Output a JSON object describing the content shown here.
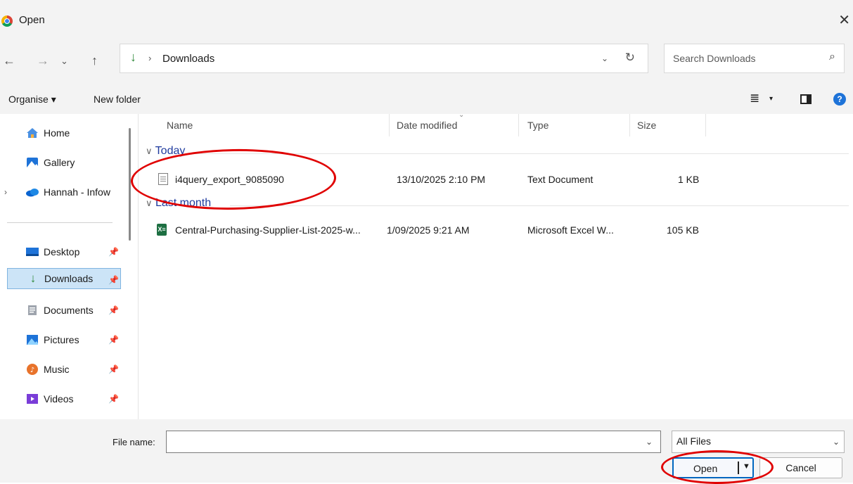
{
  "window": {
    "title": "Open",
    "close_glyph": "✕"
  },
  "nav": {
    "back": "←",
    "forward": "→",
    "recent": "⌄",
    "up": "↑"
  },
  "address": {
    "chevron": "›",
    "path": "Downloads",
    "dropdown": "⌄",
    "refresh": "↻"
  },
  "search": {
    "placeholder": "Search Downloads",
    "icon": "⌕"
  },
  "toolbar": {
    "organise": "Organise ▾",
    "new_folder": "New folder",
    "view": "≣",
    "view_drop": "▾",
    "help": "?"
  },
  "sidebar": {
    "items": [
      {
        "label": "Home",
        "icon": "home-icon",
        "pinned": false
      },
      {
        "label": "Gallery",
        "icon": "gallery-icon",
        "pinned": false
      },
      {
        "label": "Hannah - Infow",
        "icon": "onedrive-icon",
        "pinned": false
      },
      {
        "label": "Desktop",
        "icon": "desktop-icon",
        "pinned": true
      },
      {
        "label": "Downloads",
        "icon": "downloads-icon",
        "pinned": true,
        "selected": true
      },
      {
        "label": "Documents",
        "icon": "documents-icon",
        "pinned": true
      },
      {
        "label": "Pictures",
        "icon": "pictures-icon",
        "pinned": true
      },
      {
        "label": "Music",
        "icon": "music-icon",
        "pinned": true
      },
      {
        "label": "Videos",
        "icon": "videos-icon",
        "pinned": true
      }
    ],
    "expand": "›",
    "pin": "📌"
  },
  "columns": {
    "name": "Name",
    "date": "Date modified",
    "type": "Type",
    "size": "Size",
    "sort": "⌄"
  },
  "groups": [
    {
      "label": "Today",
      "chevron": "∨",
      "files": [
        {
          "name": "i4query_export_9085090",
          "date": "13/10/2025 2:10 PM",
          "type": "Text Document",
          "size": "1 KB",
          "icon": "text-file-icon"
        }
      ]
    },
    {
      "label": "Last month",
      "chevron": "∨",
      "files": [
        {
          "name": "Central-Purchasing-Supplier-List-2025-w...",
          "date": "1/09/2025 9:21 AM",
          "type": "Microsoft Excel W...",
          "size": "105 KB",
          "icon": "excel-file-icon",
          "icon_text": "X≡"
        }
      ]
    }
  ],
  "footer": {
    "file_name_label": "File name:",
    "file_name_value": "",
    "file_name_drop": "⌄",
    "filter_value": "All Files",
    "filter_drop": "⌄",
    "open_label": "Open",
    "open_arrow": "▼",
    "cancel_label": "Cancel"
  },
  "colors": {
    "accent": "#0067c0",
    "selection": "#cce4f7",
    "annotation": "#e00000",
    "group_header": "#1f3b9e"
  }
}
